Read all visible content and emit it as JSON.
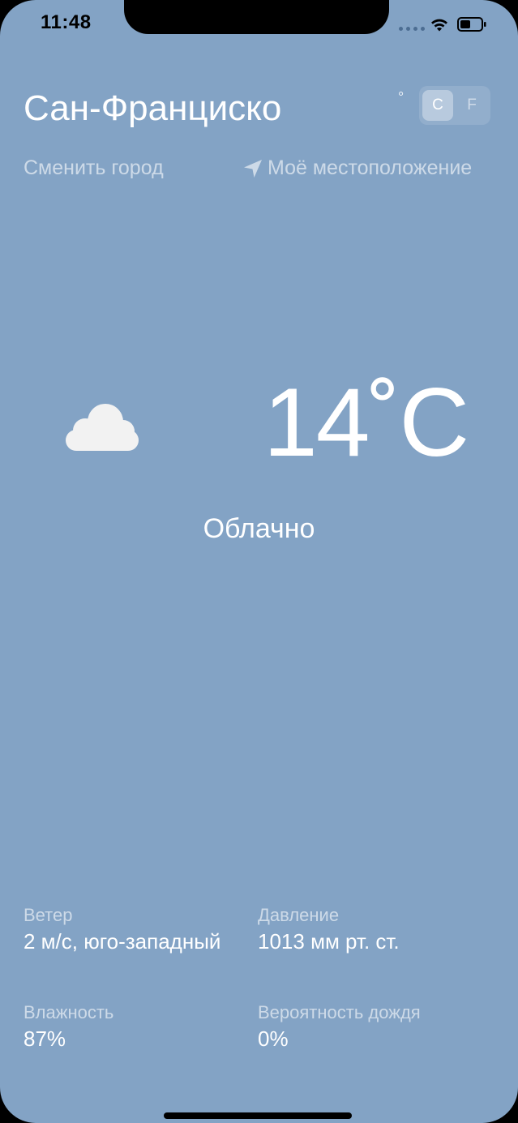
{
  "status_bar": {
    "time": "11:48",
    "icons": [
      "signal-dots-icon",
      "wifi-icon",
      "battery-icon"
    ]
  },
  "header": {
    "city": "Сан-Франциско",
    "unit_degree_mark": "°",
    "units": [
      "C",
      "F"
    ],
    "selected_unit": "C"
  },
  "actions": {
    "change_city": "Сменить город",
    "my_location": "Моё местоположение",
    "location_icon": "location-arrow-icon"
  },
  "current": {
    "icon": "cloud-icon",
    "temperature": "14˚C",
    "condition": "Облачно"
  },
  "details": {
    "wind": {
      "label": "Ветер",
      "value": "2 м/с, юго-западный"
    },
    "pressure": {
      "label": "Давление",
      "value": "1013 мм рт. ст."
    },
    "humidity": {
      "label": "Влажность",
      "value": "87%"
    },
    "rain_chance": {
      "label": "Вероятность дождя",
      "value": "0%"
    }
  },
  "colors": {
    "background": "#83a3c5",
    "text": "#ffffff",
    "muted_text": "rgba(255,255,255,0.6)"
  }
}
